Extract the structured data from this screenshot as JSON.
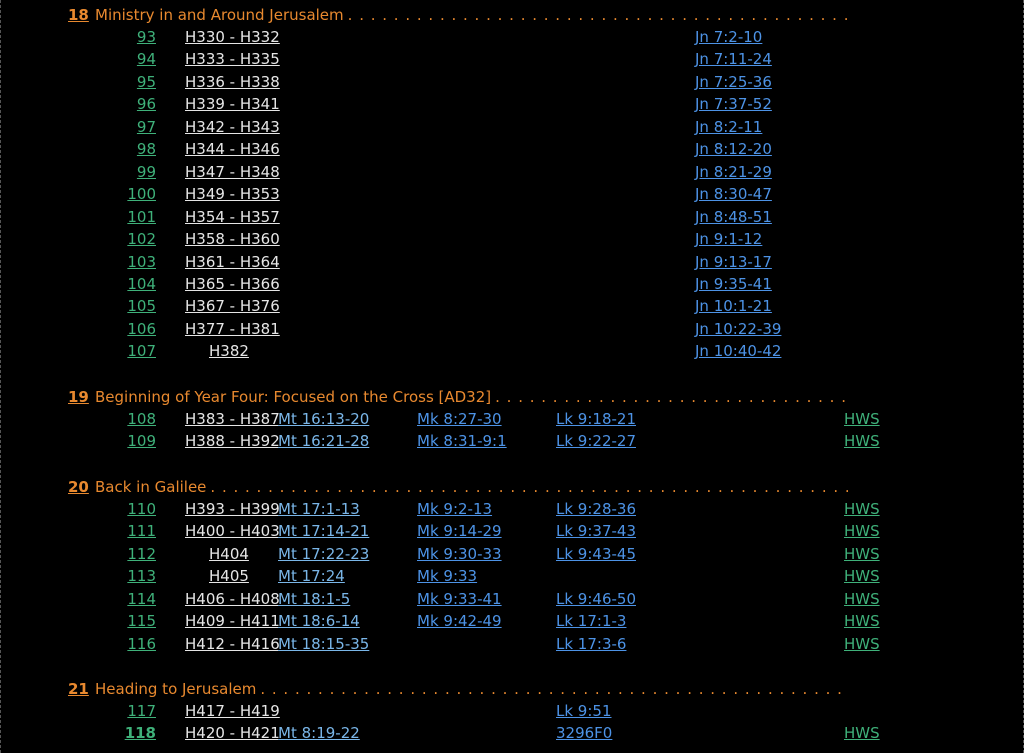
{
  "sections": [
    {
      "num": "18",
      "title": "Ministry in and Around Jerusalem",
      "rows": [
        {
          "num": "93",
          "h": "H330 - H332",
          "jn": "Jn 7:2-10"
        },
        {
          "num": "94",
          "h": "H333 - H335",
          "jn": "Jn 7:11-24"
        },
        {
          "num": "95",
          "h": "H336 - H338",
          "jn": "Jn 7:25-36"
        },
        {
          "num": "96",
          "h": "H339 - H341",
          "jn": "Jn 7:37-52"
        },
        {
          "num": "97",
          "h": "H342 - H343",
          "jn": "Jn 8:2-11"
        },
        {
          "num": "98",
          "h": "H344 - H346",
          "jn": "Jn 8:12-20"
        },
        {
          "num": "99",
          "h": "H347 - H348",
          "jn": "Jn 8:21-29"
        },
        {
          "num": "100",
          "h": "H349 - H353",
          "jn": "Jn 8:30-47"
        },
        {
          "num": "101",
          "h": "H354 - H357",
          "jn": "Jn 8:48-51"
        },
        {
          "num": "102",
          "h": "H358 - H360",
          "jn": "Jn 9:1-12"
        },
        {
          "num": "103",
          "h": "H361 - H364",
          "jn": "Jn 9:13-17"
        },
        {
          "num": "104",
          "h": "H365 - H366",
          "jn": "Jn 9:35-41"
        },
        {
          "num": "105",
          "h": "H367 - H376",
          "jn": "Jn 10:1-21"
        },
        {
          "num": "106",
          "h": "H377 - H381",
          "jn": "Jn 10:22-39"
        },
        {
          "num": "107",
          "h": "H382",
          "single": true,
          "jn": "Jn 10:40-42"
        }
      ]
    },
    {
      "num": "19",
      "title": "Beginning of Year Four: Focused on the Cross [AD32]",
      "rows": [
        {
          "num": "108",
          "h": "H383 - H387",
          "mt": "Mt 16:13-20",
          "mk": "Mk 8:27-30",
          "lk": "Lk 9:18-21",
          "hws": "HWS"
        },
        {
          "num": "109",
          "h": "H388 - H392",
          "mt": "Mt 16:21-28",
          "mk": "Mk 8:31-9:1",
          "lk": "Lk 9:22-27",
          "hws": "HWS"
        }
      ]
    },
    {
      "num": "20",
      "title": "Back in Galilee",
      "rows": [
        {
          "num": "110",
          "h": "H393 - H399",
          "mt": "Mt 17:1-13",
          "mk": "Mk 9:2-13",
          "lk": "Lk 9:28-36",
          "hws": "HWS"
        },
        {
          "num": "111",
          "h": "H400 - H403",
          "mt": "Mt 17:14-21",
          "mk": "Mk 9:14-29",
          "lk": "Lk 9:37-43",
          "hws": "HWS"
        },
        {
          "num": "112",
          "h": "H404",
          "single": true,
          "mt": "Mt 17:22-23",
          "mk": "Mk 9:30-33",
          "lk": "Lk 9:43-45",
          "hws": "HWS"
        },
        {
          "num": "113",
          "h": "H405",
          "single": true,
          "mt": "Mt 17:24",
          "mk": "Mk 9:33",
          "hws": "HWS"
        },
        {
          "num": "114",
          "h": "H406 - H408",
          "mt": "Mt 18:1-5",
          "mk": "Mk 9:33-41",
          "lk": "Lk 9:46-50",
          "hws": "HWS"
        },
        {
          "num": "115",
          "h": "H409 - H411",
          "mt": "Mt 18:6-14",
          "mk": "Mk 9:42-49",
          "lk": "Lk 17:1-3",
          "hws": "HWS"
        },
        {
          "num": "116",
          "h": "H412 - H416",
          "mt": "Mt 18:15-35",
          "lk": "Lk 17:3-6",
          "hws": "HWS"
        }
      ]
    },
    {
      "num": "21",
      "title": "Heading to Jerusalem",
      "rows": [
        {
          "num": "117",
          "h": "H417 - H419",
          "lk": "Lk 9:51"
        },
        {
          "num": "118",
          "bold": true,
          "h": "H420 - H421",
          "mt": "Mt 8:19-22",
          "lk": "3296F0",
          "hws": "HWS"
        }
      ]
    }
  ]
}
